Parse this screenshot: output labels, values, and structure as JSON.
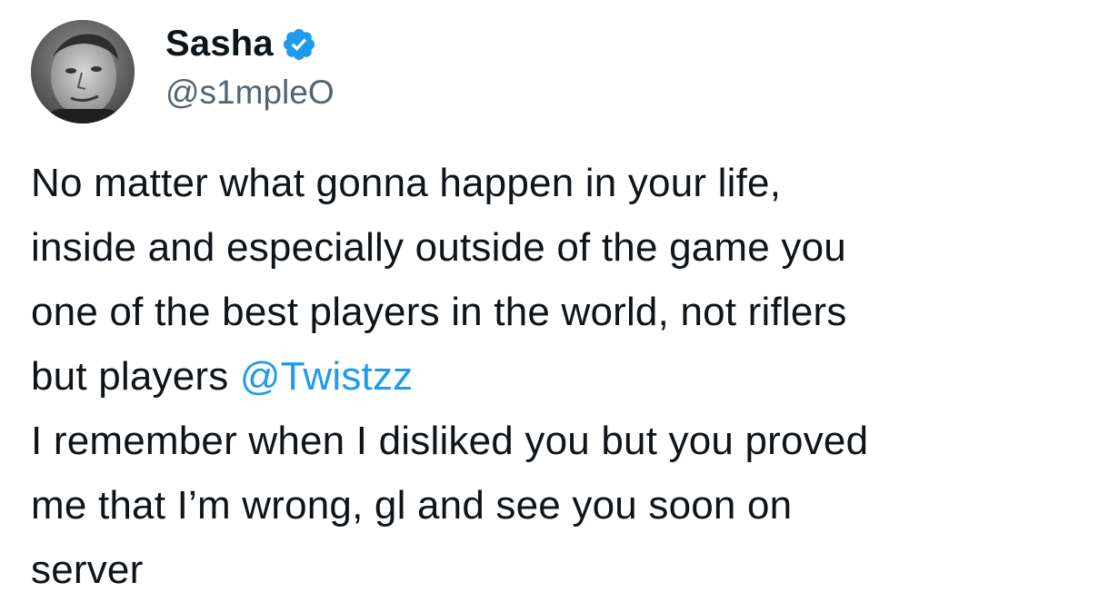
{
  "author": {
    "display_name": "Sasha",
    "handle": "@s1mpleO",
    "verified_icon": "verified-badge-icon",
    "avatar_icon": "profile-photo"
  },
  "tweet": {
    "lines": [
      {
        "text": "No matter what gonna happen in your life,"
      },
      {
        "text": "inside and especially outside of the game you"
      },
      {
        "text": "one of the best players in the world, not riflers"
      },
      {
        "text": "but players ",
        "mention": "@Twistzz"
      },
      {
        "text": "I remember when I disliked you but you proved"
      },
      {
        "text": "me that I’m wrong, gl and see you soon on"
      },
      {
        "text": "server"
      }
    ]
  },
  "colors": {
    "text": "#0f1419",
    "handle": "#536471",
    "mention": "#1d9bf0",
    "verified": "#1d9bf0"
  }
}
